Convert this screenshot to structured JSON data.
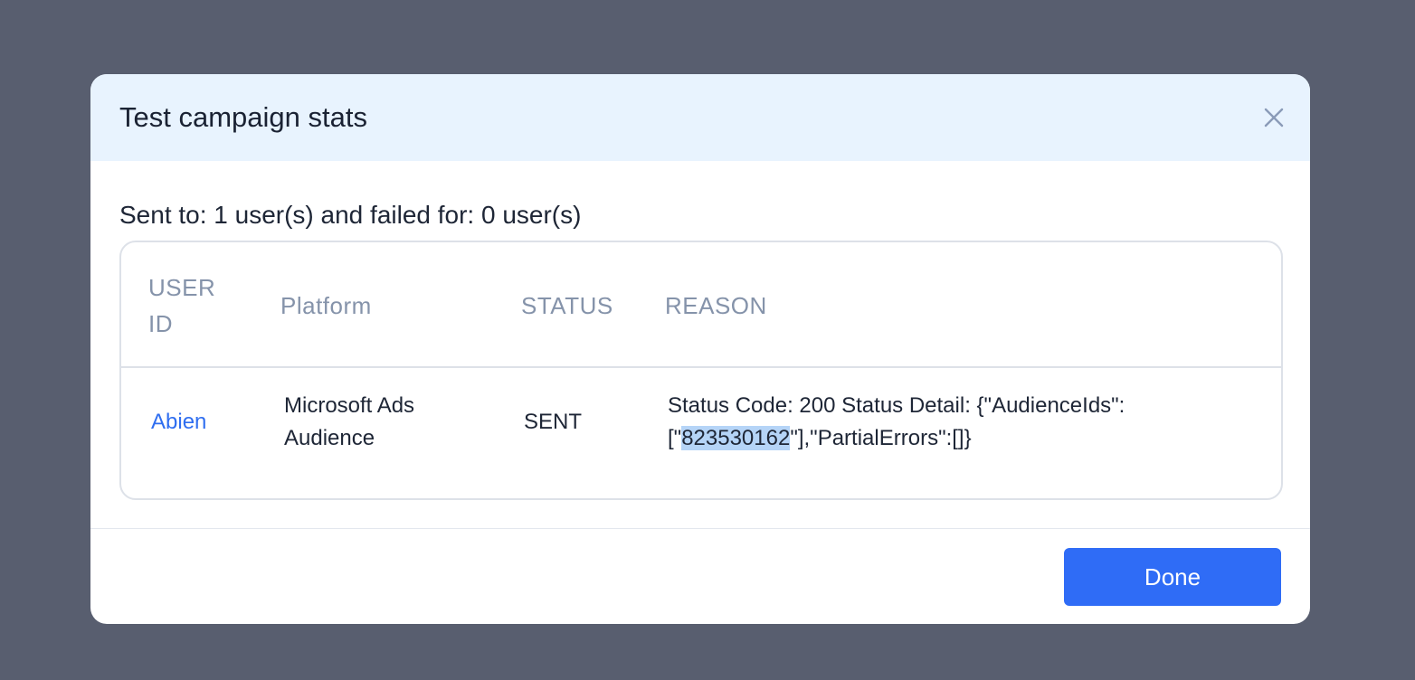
{
  "modal": {
    "title": "Test campaign stats",
    "close_icon": "close-icon",
    "summary": "Sent to: 1 user(s) and failed for: 0 user(s)",
    "done_label": "Done"
  },
  "table": {
    "headers": {
      "user_id": "USER ID",
      "platform": "Platform",
      "status": "STATUS",
      "reason": "REASON"
    },
    "rows": [
      {
        "user_id": "Abien",
        "platform": "Microsoft Ads Audience",
        "status": "SENT",
        "reason_before": "Status Code: 200 Status Detail: {\"AudienceIds\":[\"",
        "reason_highlight": "823530162",
        "reason_after": "\"],\"PartialErrors\":[]}"
      }
    ]
  },
  "colors": {
    "backdrop": "#585e6f",
    "header_bg": "#e8f3fe",
    "accent": "#2f6cf6",
    "link": "#2f6ef0",
    "header_text": "#8593aa",
    "selection": "#b5d4f7"
  }
}
